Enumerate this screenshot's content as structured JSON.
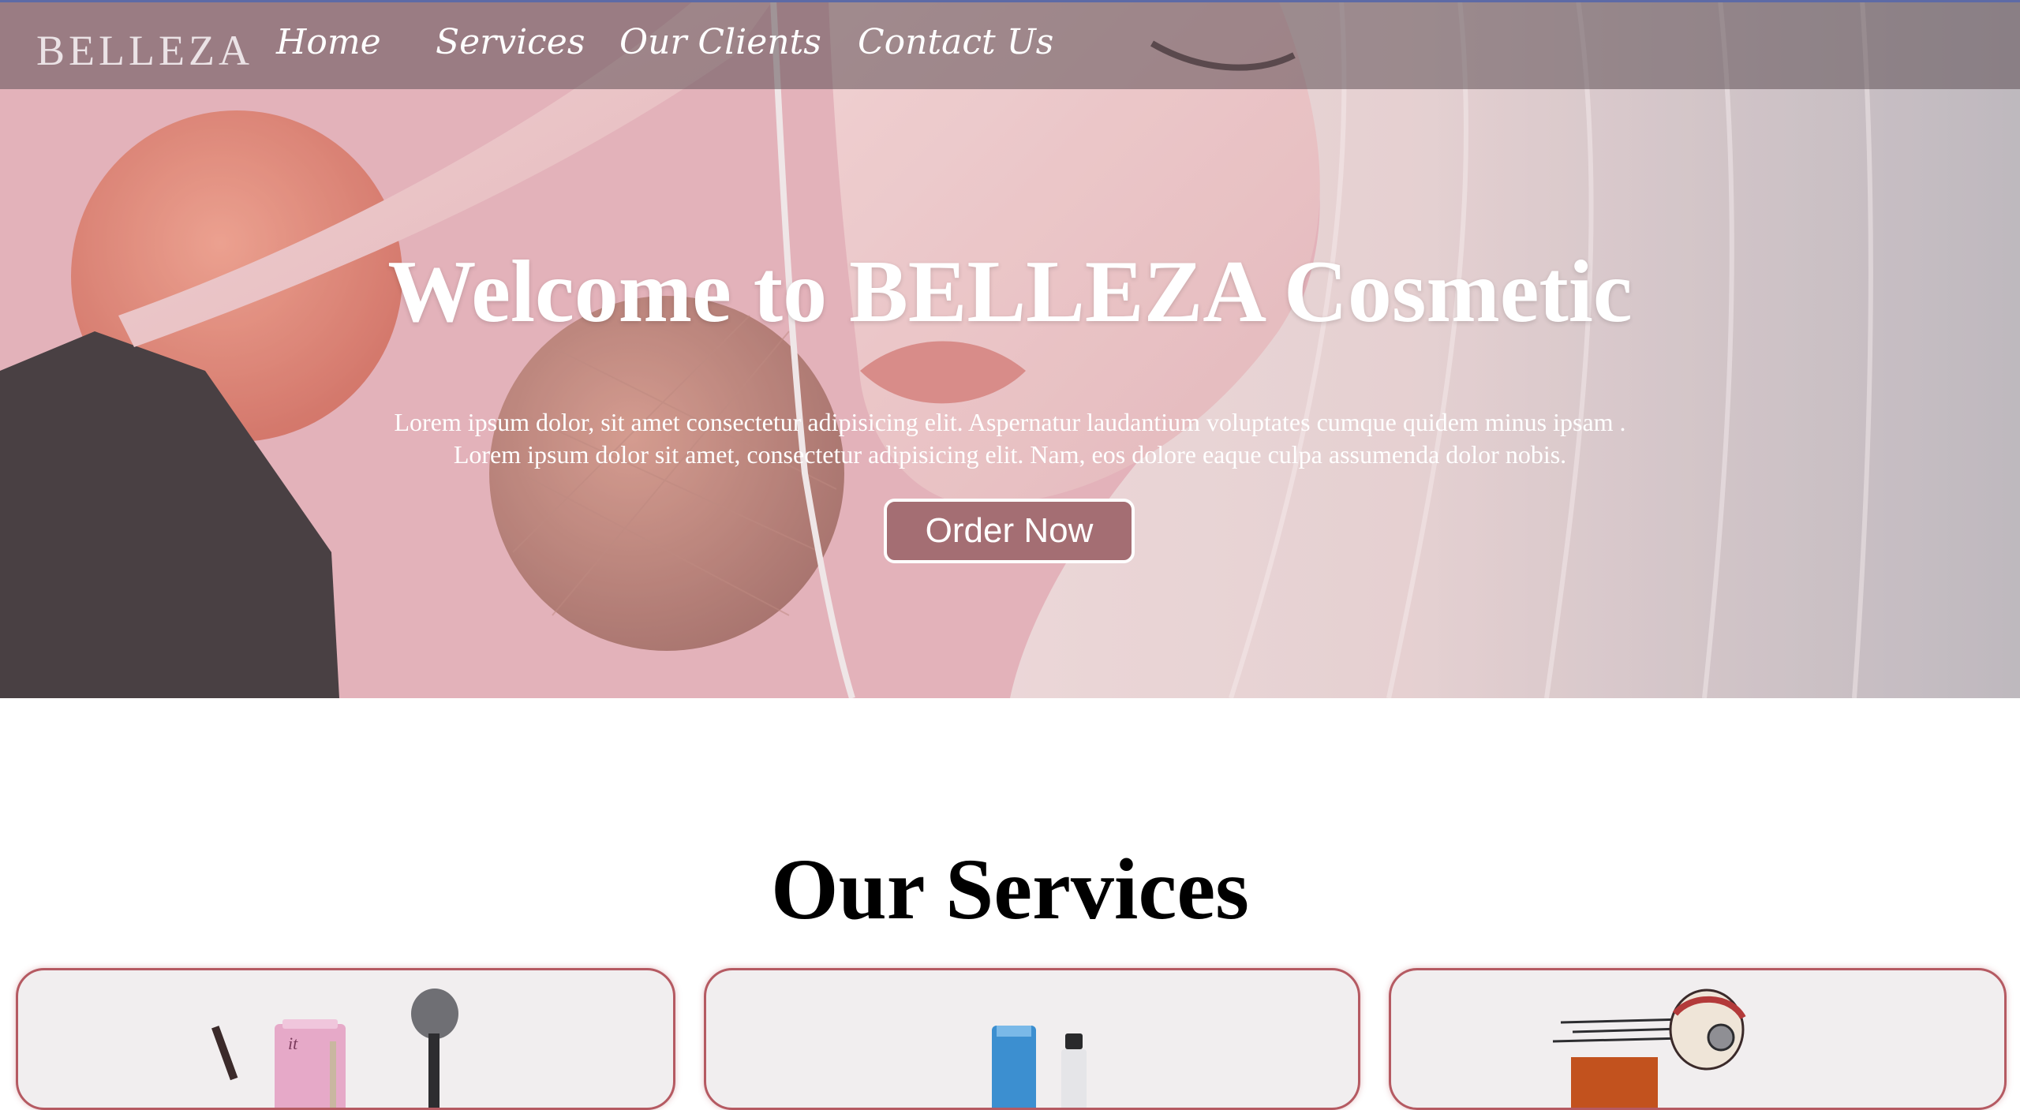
{
  "nav": {
    "brand": "BELLEZA",
    "links": [
      "Home",
      "Services",
      "Our Clients",
      "Contact Us"
    ]
  },
  "hero": {
    "title": "Welcome to BELLEZA Cosmetic",
    "text_line1": "Lorem ipsum dolor, sit amet consectetur adipisicing elit. Aspernatur laudantium voluptates cumque quidem minus ipsam .",
    "text_line2": "Lorem ipsum dolor sit amet, consectetur adipisicing elit. Nam, eos dolore eaque culpa assumenda dolor nobis.",
    "button_label": "Order Now"
  },
  "services": {
    "title": "Our Services",
    "cards": [
      {
        "image": "makeup-products-image"
      },
      {
        "image": "skincare-bottles-image"
      },
      {
        "image": "delivery-helmet-image"
      }
    ]
  },
  "colors": {
    "nav_bg": "#5f5055",
    "nav_top_border": "#5d6aa6",
    "accent": "#a46e73",
    "card_border": "#b55a62",
    "card_bg": "#f1eeef"
  }
}
